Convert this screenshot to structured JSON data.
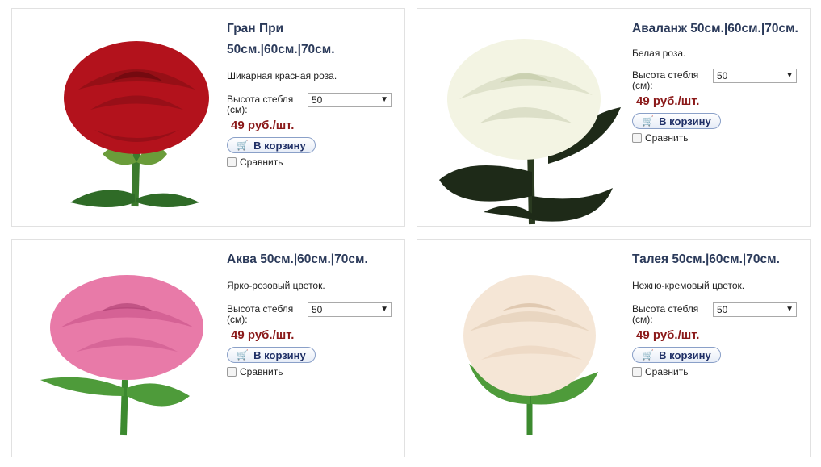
{
  "products": [
    {
      "title_line1": "Гран При",
      "title_line2": "50см.|60см.|70см.",
      "description": "Шикарная красная роза.",
      "height_label": "Высота стебля (см):",
      "height_value": "50",
      "price": "49 руб./шт.",
      "cart_label": "В корзину",
      "compare_label": "Сравнить",
      "rose_color": "#b3121c"
    },
    {
      "title_line1": "Аваланж 50см.|60см.|70см.",
      "description": "Белая роза.",
      "height_label": "Высота стебля (см):",
      "height_value": "50",
      "price": "49 руб./шт.",
      "cart_label": "В корзину",
      "compare_label": "Сравнить",
      "rose_color": "#f3f4e3"
    },
    {
      "title_line1": "Аква 50см.|60см.|70см.",
      "description": "Ярко-розовый цветок.",
      "height_label": "Высота стебля (см):",
      "height_value": "50",
      "price": "49 руб./шт.",
      "cart_label": "В корзину",
      "compare_label": "Сравнить",
      "rose_color": "#e87aa8"
    },
    {
      "title_line1": "Талея 50см.|60см.|70см.",
      "description": "Нежно-кремовый цветок.",
      "height_label": "Высота стебля (см):",
      "height_value": "50",
      "price": "49 руб./шт.",
      "cart_label": "В корзину",
      "compare_label": "Сравнить",
      "rose_color": "#f5e6d6"
    }
  ],
  "icons": {
    "cart": "cart-icon",
    "dropdown": "chevron-down-icon"
  }
}
